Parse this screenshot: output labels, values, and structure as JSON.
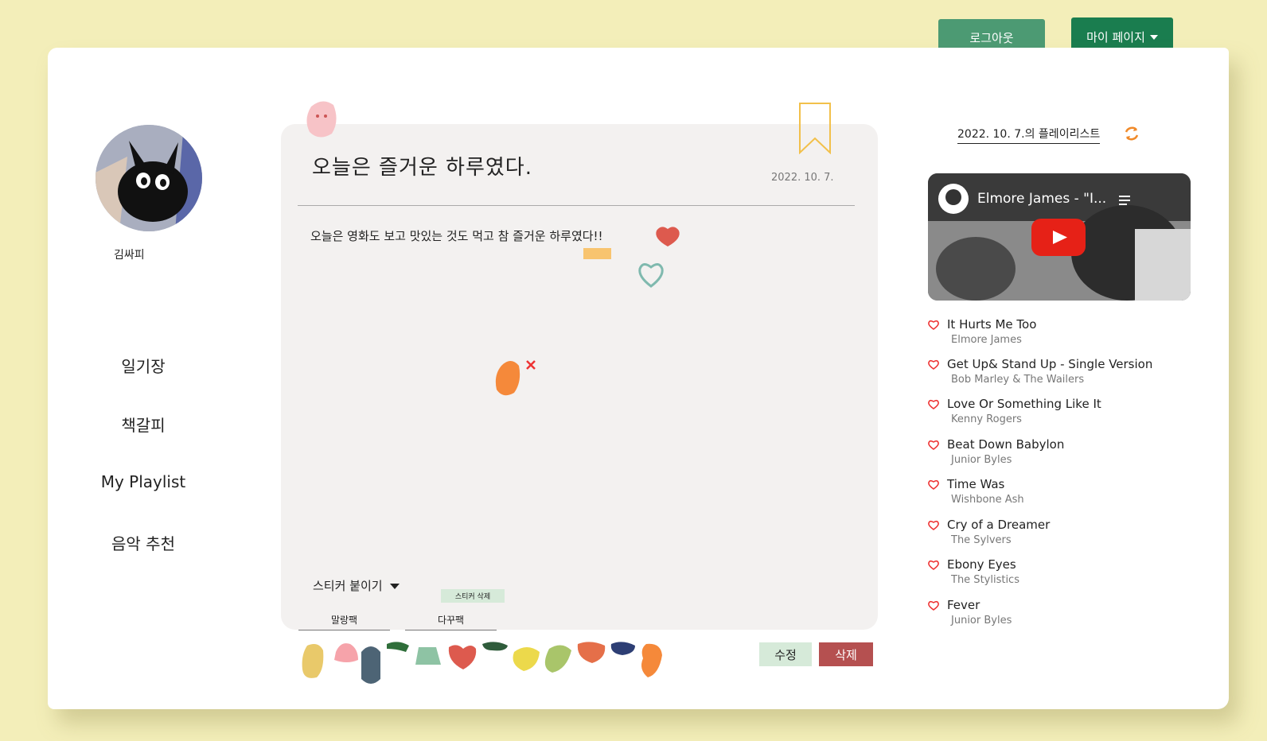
{
  "header": {
    "logout_label": "로그아웃",
    "mypage_label": "마이 페이지"
  },
  "profile": {
    "username": "김싸피"
  },
  "nav": [
    "일기장",
    "책갈피",
    "My Playlist",
    "음악 추천"
  ],
  "diary": {
    "title": "오늘은 즐거운 하루였다.",
    "date": "2022. 10. 7.",
    "body": "오늘은 영화도 보고 맛있는 것도 먹고 참 즐거운 하루였다!!",
    "sticker_toggle": "스티커 붙이기",
    "sticker_delete": "스티커 삭제",
    "packs": [
      "말랑팩",
      "다꾸팩"
    ],
    "edit_label": "수정",
    "delete_label": "삭제"
  },
  "playlist": {
    "title": "2022. 10. 7.의 플레이리스트",
    "video_title": "Elmore James - \"I...",
    "songs": [
      {
        "title": "It Hurts Me Too",
        "artist": "Elmore James"
      },
      {
        "title": "Get Up& Stand Up - Single Version",
        "artist": "Bob Marley & The Wailers"
      },
      {
        "title": "Love Or Something Like It",
        "artist": "Kenny Rogers"
      },
      {
        "title": "Beat Down Babylon",
        "artist": "Junior Byles"
      },
      {
        "title": "Time Was",
        "artist": "Wishbone Ash"
      },
      {
        "title": "Cry of a Dreamer",
        "artist": "The Sylvers"
      },
      {
        "title": "Ebony Eyes",
        "artist": "The Stylistics"
      },
      {
        "title": "Fever",
        "artist": "Junior Byles"
      }
    ]
  },
  "colors": {
    "background": "#f3eeb9",
    "logout": "#4c9a73",
    "mypage": "#1a7d4f",
    "delete": "#b55050",
    "edit": "#d6ead9"
  }
}
